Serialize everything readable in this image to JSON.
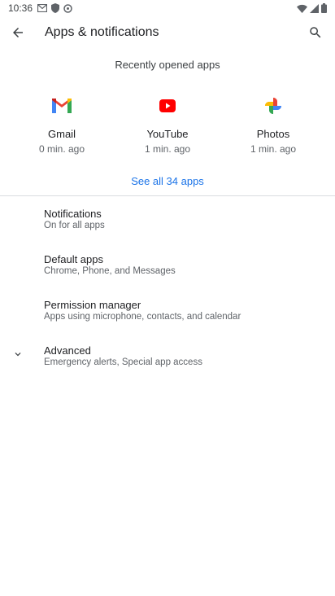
{
  "status_bar": {
    "time": "10:36"
  },
  "app_bar": {
    "title": "Apps & notifications"
  },
  "recent": {
    "header": "Recently opened apps",
    "apps": [
      {
        "name": "Gmail",
        "time": "0 min. ago"
      },
      {
        "name": "YouTube",
        "time": "1 min. ago"
      },
      {
        "name": "Photos",
        "time": "1 min. ago"
      }
    ],
    "see_all": "See all 34 apps"
  },
  "settings": [
    {
      "title": "Notifications",
      "summary": "On for all apps"
    },
    {
      "title": "Default apps",
      "summary": "Chrome, Phone, and Messages"
    },
    {
      "title": "Permission manager",
      "summary": "Apps using microphone, contacts, and calendar"
    },
    {
      "title": "Advanced",
      "summary": "Emergency alerts, Special app access"
    }
  ],
  "colors": {
    "accent": "#1a73e8",
    "text_primary": "#202124",
    "text_secondary": "#5f6368"
  }
}
